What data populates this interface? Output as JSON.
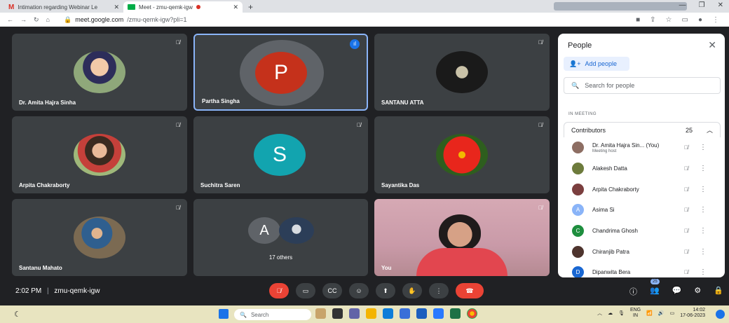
{
  "browser": {
    "tabs": [
      {
        "title": "Intimation regarding Webinar Le",
        "close": "✕"
      },
      {
        "title": "Meet - zmu-qemk-igw",
        "close": "✕"
      }
    ],
    "new_tab": "+",
    "url_host": "meet.google.com",
    "url_path": "/zmu-qemk-igw?pli=1"
  },
  "tiles": [
    {
      "name": "Dr. Amita Hajra Sinha"
    },
    {
      "name": "Partha Singha",
      "letter": "P"
    },
    {
      "name": "SANTANU ATTA"
    },
    {
      "name": "Arpita Chakraborty"
    },
    {
      "name": "Suchitra Saren",
      "letter": "S"
    },
    {
      "name": "Sayantika Das"
    },
    {
      "name": "Santanu Mahato"
    },
    {
      "name": "17 others",
      "letter": "A"
    },
    {
      "name": "You"
    }
  ],
  "panel": {
    "title": "People",
    "add_people": "Add people",
    "search_placeholder": "Search for people",
    "section": "IN MEETING",
    "contributors_label": "Contributors",
    "contributors_count": "25",
    "people": [
      {
        "name": "Dr. Amita Hajra Sin... (You)",
        "sub": "Meeting host",
        "color": "#8d6e63"
      },
      {
        "name": "Alakesh Datta",
        "color": "#6d7b3c"
      },
      {
        "name": "Arpita Chakraborty",
        "color": "#7b3f3f"
      },
      {
        "name": "Asima Si",
        "letter": "A",
        "color": "#8ab4f8"
      },
      {
        "name": "Chandrima Ghosh",
        "letter": "C",
        "color": "#1e8e3e"
      },
      {
        "name": "Chiranjib Patra",
        "color": "#4e342e"
      },
      {
        "name": "Dipanwita Bera",
        "letter": "D",
        "color": "#1967d2"
      }
    ]
  },
  "bottom": {
    "time": "2:02 PM",
    "separator": "|",
    "meeting_code": "zmu-qemk-igw",
    "people_badge": "25"
  },
  "taskbar": {
    "search": "Search",
    "lang_top": "ENG",
    "lang_bottom": "IN",
    "time": "14:02",
    "date": "17-06-2023"
  }
}
